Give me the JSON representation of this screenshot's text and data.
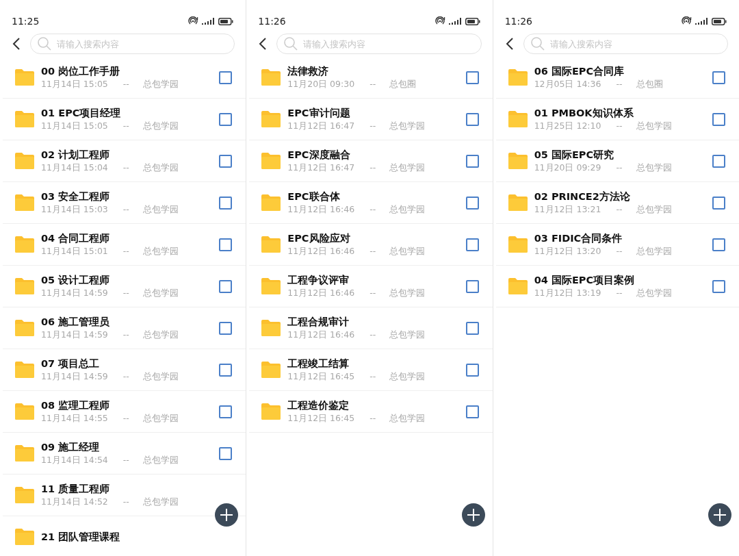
{
  "screens": [
    {
      "time": "11:25",
      "search": {
        "placeholder": "请输入搜索内容"
      },
      "items": [
        {
          "title": "00 岗位工作手册",
          "date": "11月14日 15:05",
          "separator": "--",
          "source": "总包学园",
          "checked": false
        },
        {
          "title": "01 EPC项目经理",
          "date": "11月14日 15:05",
          "separator": "--",
          "source": "总包学园",
          "checked": false
        },
        {
          "title": "02 计划工程师",
          "date": "11月14日 15:04",
          "separator": "--",
          "source": "总包学园",
          "checked": false
        },
        {
          "title": "03 安全工程师",
          "date": "11月14日 15:03",
          "separator": "--",
          "source": "总包学园",
          "checked": false
        },
        {
          "title": "04 合同工程师",
          "date": "11月14日 15:01",
          "separator": "--",
          "source": "总包学园",
          "checked": false
        },
        {
          "title": "05 设计工程师",
          "date": "11月14日 14:59",
          "separator": "--",
          "source": "总包学园",
          "checked": false
        },
        {
          "title": "06 施工管理员",
          "date": "11月14日 14:59",
          "separator": "--",
          "source": "总包学园",
          "checked": false
        },
        {
          "title": "07 项目总工",
          "date": "11月14日 14:59",
          "separator": "--",
          "source": "总包学园",
          "checked": false
        },
        {
          "title": "08 监理工程师",
          "date": "11月14日 14:55",
          "separator": "--",
          "source": "总包学园",
          "checked": false
        },
        {
          "title": "09 施工经理",
          "date": "11月14日 14:54",
          "separator": "--",
          "source": "总包学园",
          "checked": false
        },
        {
          "title": "11 质量工程师",
          "date": "11月14日 14:52",
          "separator": "--",
          "source": "总包学园"
        },
        {
          "title": "21 团队管理课程"
        }
      ]
    },
    {
      "time": "11:26",
      "search": {
        "placeholder": "请输入搜索内容"
      },
      "items": [
        {
          "title": "法律救济",
          "date": "11月20日 09:30",
          "separator": "--",
          "source": "总包圈",
          "checked": false
        },
        {
          "title": "EPC审计问题",
          "date": "11月12日 16:47",
          "separator": "--",
          "source": "总包学园",
          "checked": false
        },
        {
          "title": "EPC深度融合",
          "date": "11月12日 16:47",
          "separator": "--",
          "source": "总包学园",
          "checked": false
        },
        {
          "title": "EPC联合体",
          "date": "11月12日 16:46",
          "separator": "--",
          "source": "总包学园",
          "checked": false
        },
        {
          "title": "EPC风险应对",
          "date": "11月12日 16:46",
          "separator": "--",
          "source": "总包学园",
          "checked": false
        },
        {
          "title": "工程争议评审",
          "date": "11月12日 16:46",
          "separator": "--",
          "source": "总包学园",
          "checked": false
        },
        {
          "title": "工程合规审计",
          "date": "11月12日 16:46",
          "separator": "--",
          "source": "总包学园",
          "checked": false
        },
        {
          "title": "工程竣工结算",
          "date": "11月12日 16:45",
          "separator": "--",
          "source": "总包学园",
          "checked": false
        },
        {
          "title": "工程造价鉴定",
          "date": "11月12日 16:45",
          "separator": "--",
          "source": "总包学园",
          "checked": false
        }
      ]
    },
    {
      "time": "11:26",
      "search": {
        "placeholder": "请输入搜索内容"
      },
      "items": [
        {
          "title": "06 国际EPC合同库",
          "date": "12月05日 14:36",
          "separator": "--",
          "source": "总包圈",
          "checked": false
        },
        {
          "title": "01 PMBOK知识体系",
          "date": "11月25日 12:10",
          "separator": "--",
          "source": "总包学园",
          "checked": false
        },
        {
          "title": "05 国际EPC研究",
          "date": "11月20日 09:29",
          "separator": "--",
          "source": "总包学园",
          "checked": false
        },
        {
          "title": "02 PRINCE2方法论",
          "date": "11月12日 13:21",
          "separator": "--",
          "source": "总包学园",
          "checked": false
        },
        {
          "title": "03 FIDIC合同条件",
          "date": "11月12日 13:20",
          "separator": "--",
          "source": "总包学园",
          "checked": false
        },
        {
          "title": "04 国际EPC项目案例",
          "date": "11月12日 13:19",
          "separator": "--",
          "source": "总包学园",
          "checked": false
        }
      ]
    }
  ]
}
